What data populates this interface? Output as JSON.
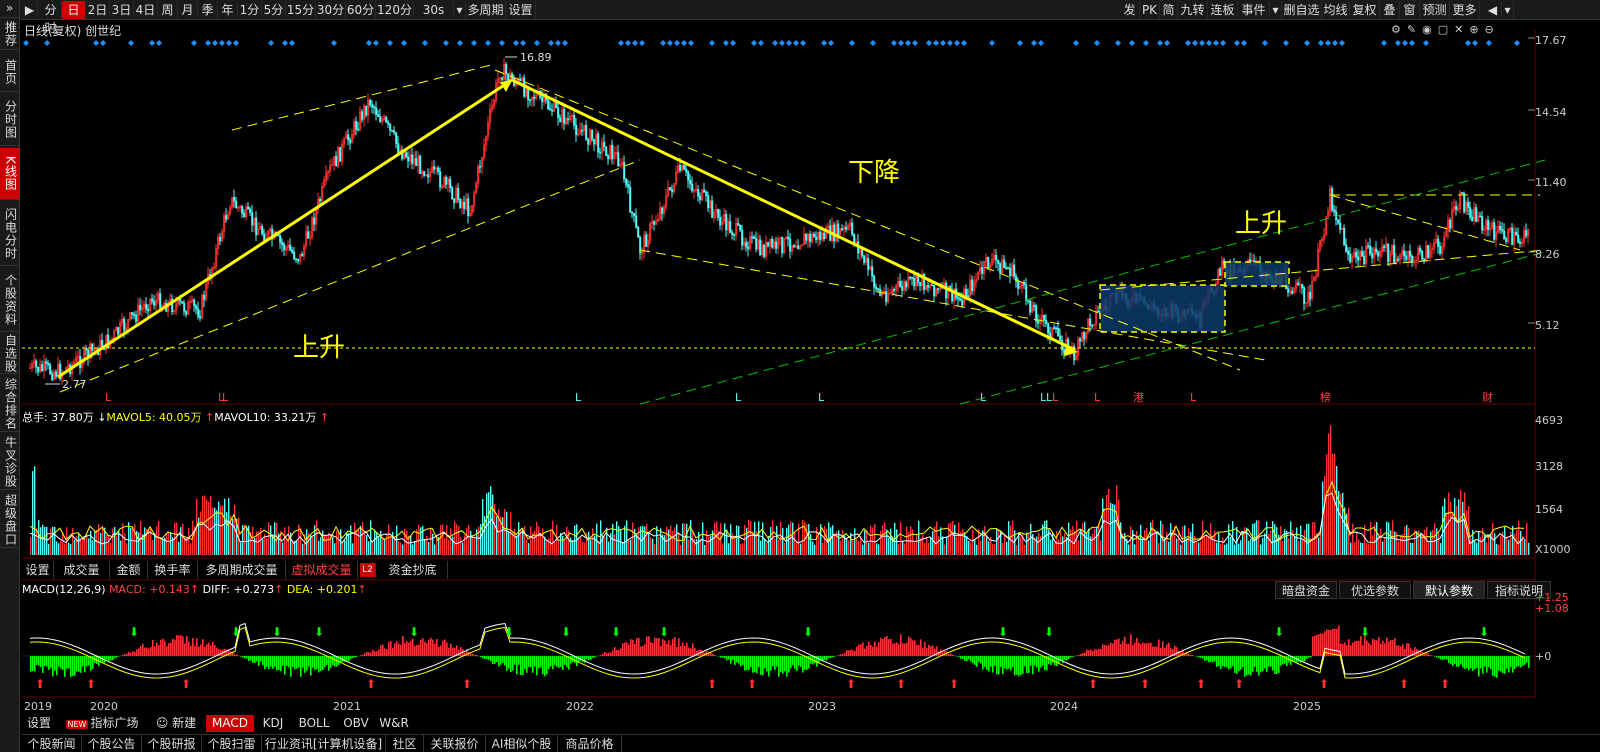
{
  "toolbar": {
    "left": [
      "分时",
      "日",
      "2日",
      "3日",
      "4日",
      "周",
      "月",
      "季",
      "年",
      "1分",
      "5分",
      "15分",
      "30分",
      "60分",
      "120分",
      "30s",
      "多周期",
      "设置"
    ],
    "active_left": "日",
    "right": [
      "发",
      "PK",
      "简",
      "九转",
      "连板",
      "事件",
      "删自选",
      "均线",
      "复权",
      "叠",
      "窗",
      "预测",
      "更多"
    ]
  },
  "sidebar": [
    "推荐",
    "首页",
    "分时图",
    "K线图",
    "闪电分时",
    "个股资料",
    "自选股",
    "综合排名",
    "牛叉诊股",
    "超级盘口"
  ],
  "sidebar_active": "K线图",
  "chart": {
    "title": "日线(复权) 创世纪",
    "price_axis": [
      "17.67",
      "14.54",
      "11.40",
      "8.26",
      "5.12"
    ],
    "high_label": "16.89",
    "low_label": "2.77",
    "annotations": [
      "上升",
      "下降",
      "上升"
    ]
  },
  "volume": {
    "legend_total": "总手: 37.80万",
    "legend_mavol5": "MAVOL5: 40.05万",
    "legend_mavol10": "MAVOL10: 33.21万",
    "axis": [
      "4693",
      "3128",
      "1564"
    ],
    "unit": "X1000",
    "tabs": [
      "设置",
      "成交量",
      "金额",
      "换手率",
      "多周期成交量",
      "虚拟成交量",
      "资金抄底"
    ],
    "active_tab": "虚拟成交量",
    "l2_badge": "L2"
  },
  "macd": {
    "legend_name": "MACD(12,26,9)",
    "legend_macd": "MACD: +0.143",
    "legend_diff": "DIFF: +0.273",
    "legend_dea": "DEA: +0.201",
    "axis": [
      "+1.25",
      "+1.08",
      "+0"
    ],
    "tabs": [
      "暗盘资金",
      "优选参数",
      "默认参数",
      "指标说明"
    ],
    "active_tab": "默认参数"
  },
  "x_axis_years": [
    "2019",
    "2020",
    "2021",
    "2022",
    "2023",
    "2024",
    "2025"
  ],
  "indicator_tabs": [
    "设置",
    "指标广场",
    "新建",
    "MACD",
    "KDJ",
    "BOLL",
    "OBV",
    "W&R"
  ],
  "indicator_active": "MACD",
  "new_badge": "NEW",
  "news_tabs": [
    "个股新闻",
    "个股公告",
    "个股研报",
    "个股扫雷",
    "行业资讯[计算机设备]",
    "社区",
    "关联报价",
    "AI相似个股",
    "商品价格"
  ],
  "markers": {
    "L": "L",
    "gang": "港",
    "bang": "榜",
    "cai": "财"
  },
  "colors": {
    "up": "#ff3232",
    "down": "#54ffff",
    "trend": "#ffff00",
    "green_channel": "#00c000",
    "diamond": "#1e90ff"
  }
}
